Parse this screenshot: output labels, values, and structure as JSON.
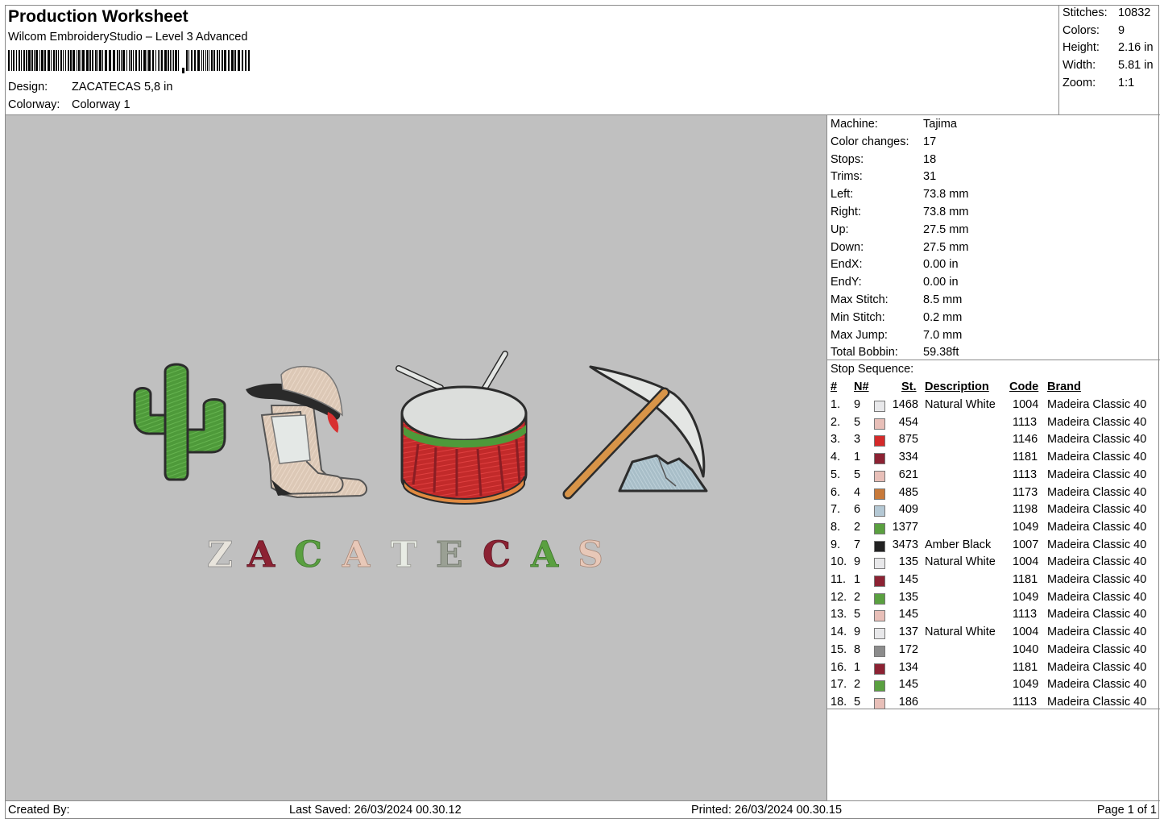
{
  "header": {
    "title": "Production Worksheet",
    "software": "Wilcom EmbroideryStudio – Level 3 Advanced",
    "design_label": "Design:",
    "design_value": "ZACATECAS 5,8 in",
    "colorway_label": "Colorway:",
    "colorway_value": "Colorway 1"
  },
  "summary": {
    "stitches_label": "Stitches:",
    "stitches_value": "10832",
    "colors_label": "Colors:",
    "colors_value": "9",
    "height_label": "Height:",
    "height_value": "2.16 in",
    "width_label": "Width:",
    "width_value": "5.81 in",
    "zoom_label": "Zoom:",
    "zoom_value": "1:1"
  },
  "info": [
    {
      "label": "Machine:",
      "value": "Tajima"
    },
    {
      "label": "Color changes:",
      "value": "17"
    },
    {
      "label": "Stops:",
      "value": "18"
    },
    {
      "label": "Trims:",
      "value": "31"
    },
    {
      "label": "Left:",
      "value": "73.8 mm"
    },
    {
      "label": "Right:",
      "value": "73.8 mm"
    },
    {
      "label": "Up:",
      "value": "27.5 mm"
    },
    {
      "label": "Down:",
      "value": "27.5 mm"
    },
    {
      "label": "EndX:",
      "value": "0.00 in"
    },
    {
      "label": "EndY:",
      "value": "0.00 in"
    },
    {
      "label": "Max Stitch:",
      "value": "8.5 mm"
    },
    {
      "label": "Min Stitch:",
      "value": "0.2 mm"
    },
    {
      "label": "Max Jump:",
      "value": "7.0 mm"
    },
    {
      "label": "Total Bobbin:",
      "value": "59.38ft"
    }
  ],
  "stops": {
    "heading": "Stop Sequence:",
    "columns": {
      "num": "#",
      "needle": "N#",
      "stitches": "St.",
      "description": "Description",
      "code": "Code",
      "brand": "Brand"
    },
    "rows": [
      {
        "num": "1.",
        "needle": "9",
        "color": "#e8e8ea",
        "stitches": "1468",
        "description": "Natural White",
        "code": "1004",
        "brand": "Madeira Classic 40"
      },
      {
        "num": "2.",
        "needle": "5",
        "color": "#e8bfb8",
        "stitches": "454",
        "description": "",
        "code": "1113",
        "brand": "Madeira Classic 40"
      },
      {
        "num": "3.",
        "needle": "3",
        "color": "#d42a2a",
        "stitches": "875",
        "description": "",
        "code": "1146",
        "brand": "Madeira Classic 40"
      },
      {
        "num": "4.",
        "needle": "1",
        "color": "#8c2233",
        "stitches": "334",
        "description": "",
        "code": "1181",
        "brand": "Madeira Classic 40"
      },
      {
        "num": "5.",
        "needle": "5",
        "color": "#e8bfb8",
        "stitches": "621",
        "description": "",
        "code": "1113",
        "brand": "Madeira Classic 40"
      },
      {
        "num": "6.",
        "needle": "4",
        "color": "#c87a3a",
        "stitches": "485",
        "description": "",
        "code": "1173",
        "brand": "Madeira Classic 40"
      },
      {
        "num": "7.",
        "needle": "6",
        "color": "#b4c8d4",
        "stitches": "409",
        "description": "",
        "code": "1198",
        "brand": "Madeira Classic 40"
      },
      {
        "num": "8.",
        "needle": "2",
        "color": "#5aa040",
        "stitches": "1377",
        "description": "",
        "code": "1049",
        "brand": "Madeira Classic 40"
      },
      {
        "num": "9.",
        "needle": "7",
        "color": "#222222",
        "stitches": "3473",
        "description": "Amber Black",
        "code": "1007",
        "brand": "Madeira Classic 40"
      },
      {
        "num": "10.",
        "needle": "9",
        "color": "#e8e8ea",
        "stitches": "135",
        "description": "Natural White",
        "code": "1004",
        "brand": "Madeira Classic 40"
      },
      {
        "num": "11.",
        "needle": "1",
        "color": "#8c2233",
        "stitches": "145",
        "description": "",
        "code": "1181",
        "brand": "Madeira Classic 40"
      },
      {
        "num": "12.",
        "needle": "2",
        "color": "#5aa040",
        "stitches": "135",
        "description": "",
        "code": "1049",
        "brand": "Madeira Classic 40"
      },
      {
        "num": "13.",
        "needle": "5",
        "color": "#e8bfb8",
        "stitches": "145",
        "description": "",
        "code": "1113",
        "brand": "Madeira Classic 40"
      },
      {
        "num": "14.",
        "needle": "9",
        "color": "#e8e8ea",
        "stitches": "137",
        "description": "Natural White",
        "code": "1004",
        "brand": "Madeira Classic 40"
      },
      {
        "num": "15.",
        "needle": "8",
        "color": "#8c8c8c",
        "stitches": "172",
        "description": "",
        "code": "1040",
        "brand": "Madeira Classic 40"
      },
      {
        "num": "16.",
        "needle": "1",
        "color": "#8c2233",
        "stitches": "134",
        "description": "",
        "code": "1181",
        "brand": "Madeira Classic 40"
      },
      {
        "num": "17.",
        "needle": "2",
        "color": "#5aa040",
        "stitches": "145",
        "description": "",
        "code": "1049",
        "brand": "Madeira Classic 40"
      },
      {
        "num": "18.",
        "needle": "5",
        "color": "#e8bfb8",
        "stitches": "186",
        "description": "",
        "code": "1113",
        "brand": "Madeira Classic 40"
      }
    ]
  },
  "design": {
    "word": "ZACATECAS",
    "letters": [
      "Z",
      "A",
      "C",
      "A",
      "T",
      "E",
      "C",
      "A",
      "S"
    ],
    "letter_colors": [
      "#e8e4dc",
      "#8c2233",
      "#5aa040",
      "#e8c8b8",
      "#e8ece4",
      "#9aa094",
      "#8c2233",
      "#5aa040",
      "#e8c8b8"
    ]
  },
  "footer": {
    "created_by": "Created By:",
    "last_saved": "Last Saved: 26/03/2024 00.30.12",
    "printed": "Printed: 26/03/2024 00.30.15",
    "page": "Page 1 of 1"
  }
}
